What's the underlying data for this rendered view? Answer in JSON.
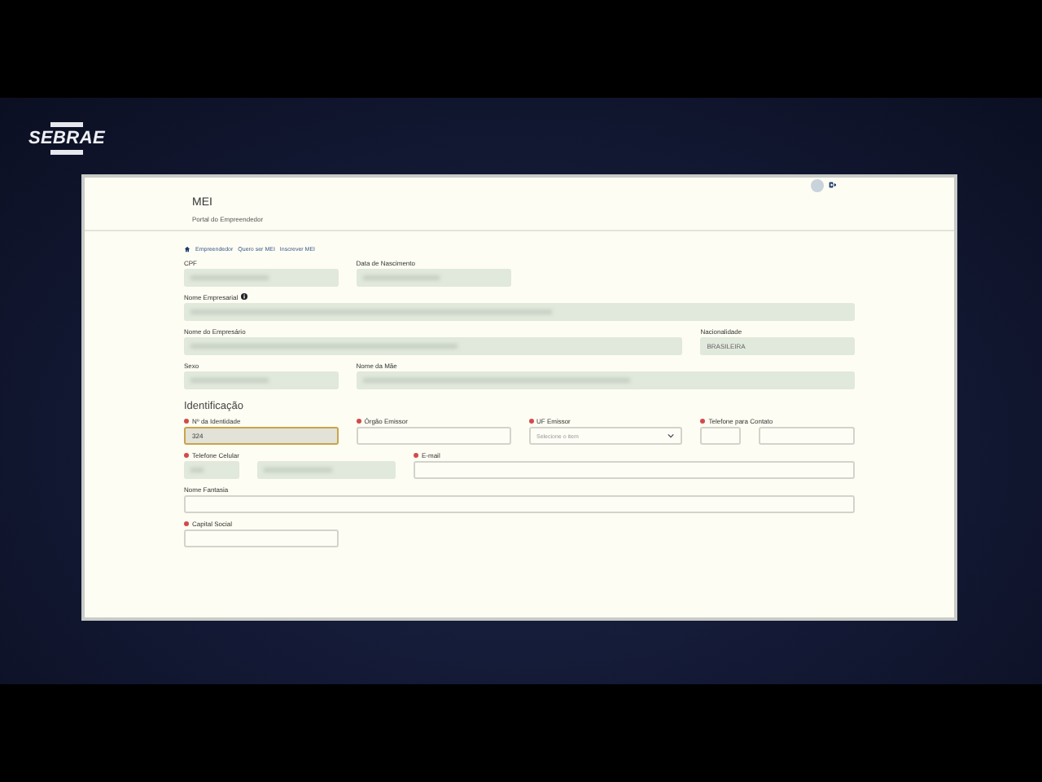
{
  "logo": {
    "text": "SEBRAE"
  },
  "header": {
    "title": "MEI",
    "subtitle": "Portal do Empreendedor"
  },
  "breadcrumb": [
    "Empreendedor",
    "Quero ser MEI",
    "Inscrever MEI"
  ],
  "personal_rows": [
    [
      {
        "label": "CPF",
        "kind": "readonly",
        "blurred": true,
        "info": false
      },
      {
        "label": "Data de Nascimento",
        "kind": "readonly",
        "blurred": true,
        "info": false
      }
    ],
    [
      {
        "label": "Nome Empresarial",
        "kind": "readonly",
        "blurred": true,
        "info": true
      }
    ],
    [
      {
        "label": "Nome do Empresário",
        "kind": "readonly",
        "blurred": true,
        "info": false
      },
      {
        "label": "Nacionalidade",
        "kind": "readonly",
        "blurred": false,
        "info": false,
        "value": "BRASILEIRA"
      }
    ],
    [
      {
        "label": "Sexo",
        "kind": "readonly",
        "blurred": true,
        "info": false
      },
      {
        "label": "Nome da Mãe",
        "kind": "readonly",
        "blurred": true,
        "info": false
      }
    ]
  ],
  "section_title": "Identificação",
  "id_rows": [
    [
      {
        "label": "Nº da Identidade",
        "required": true,
        "kind": "input",
        "value": "324",
        "focused": true
      },
      {
        "label": "Órgão Emissor",
        "required": true,
        "kind": "input",
        "focused": false
      },
      {
        "label": "UF Emissor",
        "required": true,
        "kind": "select",
        "placeholder": "Selecione o item",
        "focused": false
      },
      {
        "label": "Telefone para Contato",
        "required": true,
        "kind": "phone",
        "blurred": false,
        "focused": false
      }
    ],
    [
      {
        "label": "Telefone Celular",
        "required": true,
        "kind": "phone",
        "blurred": true,
        "focused": false
      },
      {
        "label": "E-mail",
        "required": true,
        "kind": "input",
        "focused": false
      }
    ],
    [
      {
        "label": "Nome Fantasia",
        "required": false,
        "kind": "input",
        "focused": false
      }
    ],
    [
      {
        "label": "Capital Social",
        "required": true,
        "kind": "input",
        "focused": false
      }
    ]
  ]
}
